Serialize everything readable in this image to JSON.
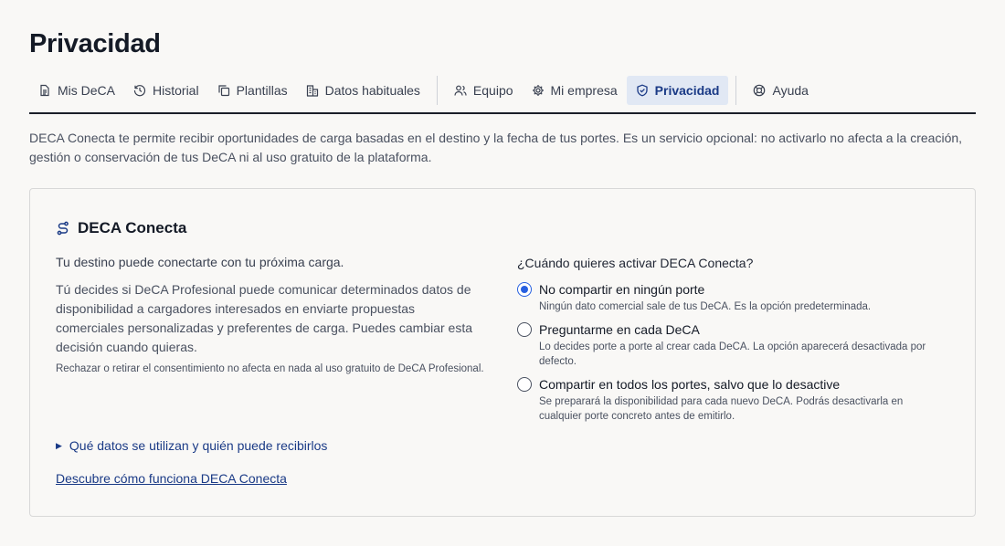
{
  "page": {
    "title": "Privacidad"
  },
  "tabs": [
    {
      "label": "Mis DeCA",
      "icon": "document-icon"
    },
    {
      "label": "Historial",
      "icon": "history-icon"
    },
    {
      "label": "Plantillas",
      "icon": "copy-icon"
    },
    {
      "label": "Datos habituales",
      "icon": "building-icon"
    },
    {
      "label": "Equipo",
      "icon": "users-icon"
    },
    {
      "label": "Mi empresa",
      "icon": "gear-icon"
    },
    {
      "label": "Privacidad",
      "icon": "shield-icon",
      "active": true
    },
    {
      "label": "Ayuda",
      "icon": "lifebuoy-icon"
    }
  ],
  "intro": "DECA Conecta te permite recibir oportunidades de carga basadas en el destino y la fecha de tus portes. Es un servicio opcional: no activarlo no afecta a la creación, gestión o conservación de tus DeCA ni al uso gratuito de la plataforma.",
  "card": {
    "title": "DECA Conecta",
    "lead": "Tu destino puede conectarte con tu próxima carga.",
    "description": "Tú decides si DeCA Profesional puede comunicar determinados datos de disponibilidad a cargadores interesados en enviarte propuestas comerciales personalizadas y preferentes de carga. Puedes cambiar esta decisión cuando quieras.",
    "note": "Rechazar o retirar el consentimiento no afecta en nada al uso gratuito de DeCA Profesional.",
    "expander": "Qué datos se utilizan y quién puede recibirlos",
    "link": "Descubre cómo funciona DECA Conecta",
    "question": "¿Cuándo quieres activar DECA Conecta?",
    "options": [
      {
        "label": "No compartir en ningún porte",
        "help": "Ningún dato comercial sale de tus DeCA. Es la opción predeterminada.",
        "selected": true
      },
      {
        "label": "Preguntarme en cada DeCA",
        "help": "Lo decides porte a porte al crear cada DeCA. La opción aparecerá desactivada por defecto.",
        "selected": false
      },
      {
        "label": "Compartir en todos los portes, salvo que lo desactive",
        "help": "Se preparará la disponibilidad para cada nuevo DeCA. Podrás desactivarla en cualquier porte concreto antes de emitirlo.",
        "selected": false
      }
    ]
  },
  "colors": {
    "accent": "#2860e0",
    "link": "#1a3a86",
    "active_tab_bg": "#e1e8f4"
  }
}
